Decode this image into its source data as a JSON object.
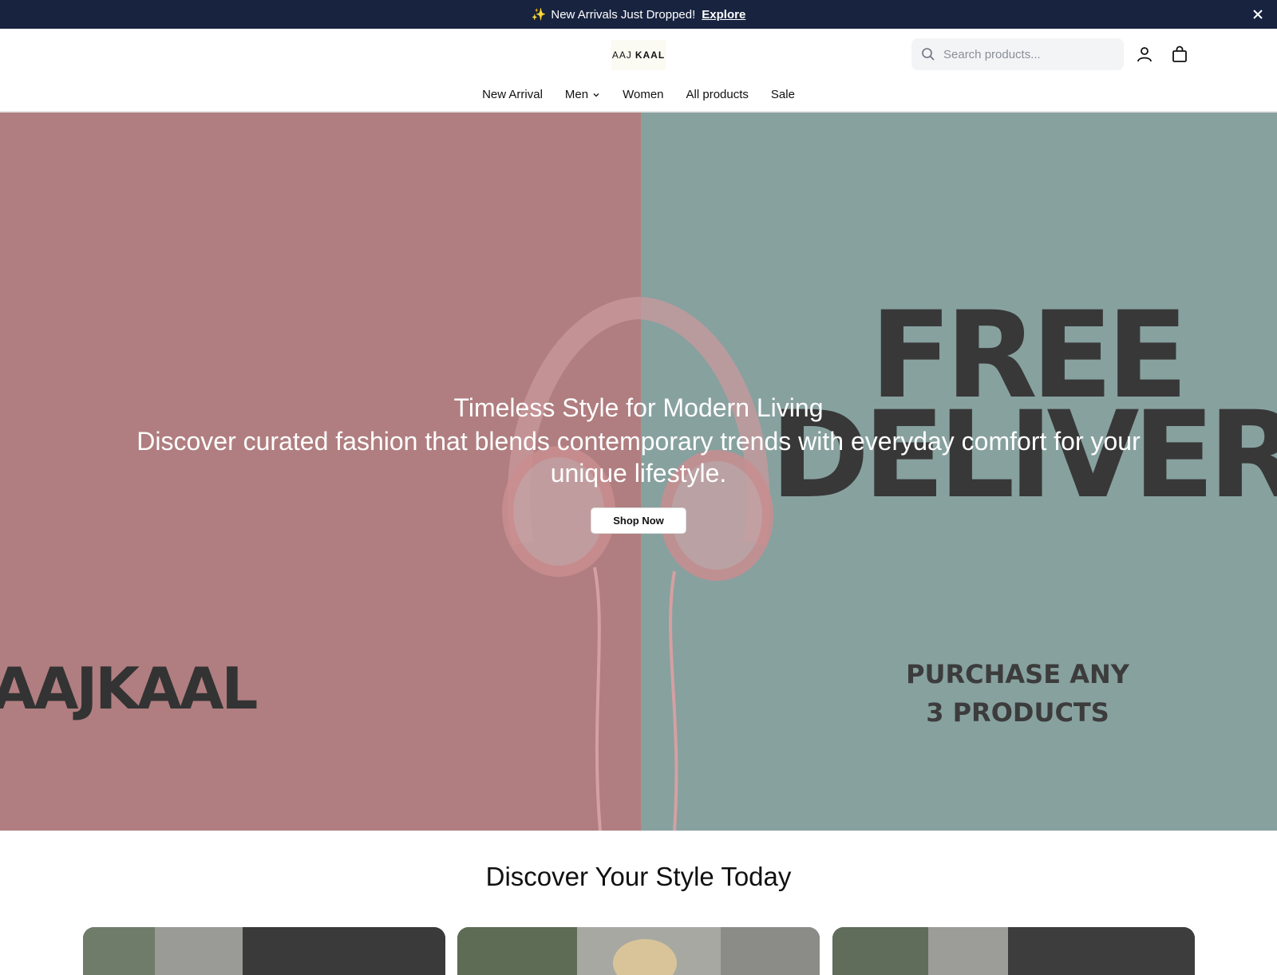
{
  "announcement": {
    "icon": "sparkles-icon",
    "text": "New Arrivals Just Dropped!",
    "link": "Explore"
  },
  "header": {
    "logo": {
      "part1": "AAJ",
      "part2": "KAAL"
    },
    "search": {
      "placeholder": "Search products..."
    },
    "icons": [
      "search-icon",
      "user-icon",
      "shopping-bag-icon"
    ]
  },
  "nav": {
    "items": [
      {
        "label": "New Arrival"
      },
      {
        "label": "Men"
      },
      {
        "label": "Women"
      },
      {
        "label": "All products"
      },
      {
        "label": "Sale"
      }
    ]
  },
  "hero": {
    "title": "Timeless Style for Modern Living",
    "subtitle": "Discover curated fashion that blends contemporary trends with everyday comfort for your unique lifestyle.",
    "cta": "Shop Now",
    "image_text": {
      "free": "FREE",
      "delivery": "DELIVERY",
      "purchase_line1": "PURCHASE ANY",
      "purchase_line2": "3 PRODUCTS",
      "brandmark": "AAJKAAL"
    }
  },
  "section": {
    "title": "Discover Your Style Today"
  },
  "colors": {
    "announcement_bg": "#182340",
    "hero_left": "#b07e80",
    "hero_right": "#87a19f"
  }
}
